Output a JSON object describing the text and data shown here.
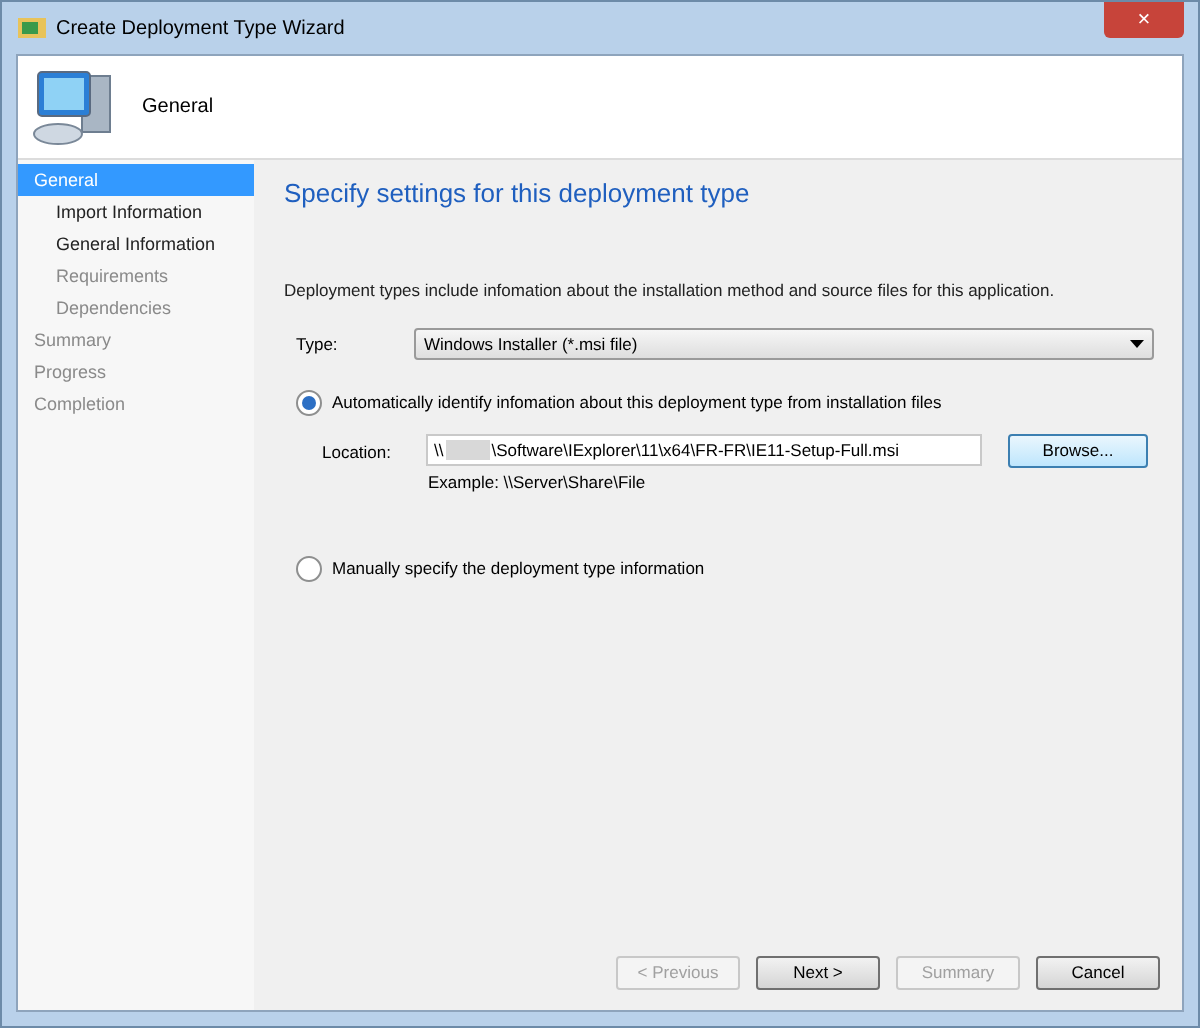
{
  "window": {
    "title": "Create Deployment Type Wizard",
    "close": "×"
  },
  "header": {
    "title": "General"
  },
  "sidebar": {
    "items": [
      {
        "label": "General",
        "selected": true,
        "enabled": true,
        "children": [
          {
            "label": "Import Information",
            "selected": false,
            "enabled": true
          },
          {
            "label": "General Information",
            "selected": false,
            "enabled": true
          },
          {
            "label": "Requirements",
            "selected": false,
            "enabled": false
          },
          {
            "label": "Dependencies",
            "selected": false,
            "enabled": false
          }
        ]
      },
      {
        "label": "Summary",
        "selected": false,
        "enabled": false
      },
      {
        "label": "Progress",
        "selected": false,
        "enabled": false
      },
      {
        "label": "Completion",
        "selected": false,
        "enabled": false
      }
    ]
  },
  "content": {
    "heading": "Specify settings for this deployment type",
    "description": "Deployment types include infomation about the installation method and source files for this application.",
    "type_label": "Type:",
    "type_value": "Windows Installer (*.msi file)",
    "options": [
      {
        "label": "Automatically identify infomation about this deployment type from installation files",
        "selected": true
      },
      {
        "label": "Manually specify the deployment type information",
        "selected": false
      }
    ],
    "location_label": "Location:",
    "location_prefix": "\\\\",
    "location_value": "\\Software\\IExplorer\\11\\x64\\FR-FR\\IE11-Setup-Full.msi",
    "example": "Example: \\\\Server\\Share\\File",
    "browse": "Browse..."
  },
  "buttons": [
    {
      "label": "< Previous",
      "disabled": true
    },
    {
      "label": "Next >",
      "disabled": false
    },
    {
      "label": "Summary",
      "disabled": true
    },
    {
      "label": "Cancel",
      "disabled": false
    }
  ]
}
